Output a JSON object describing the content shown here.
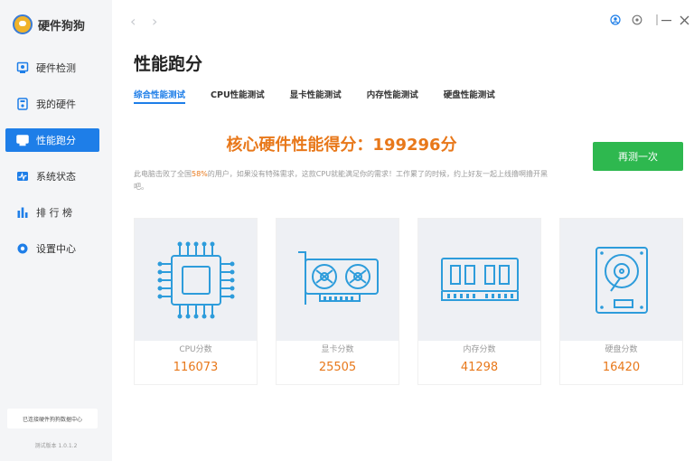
{
  "app": {
    "name": "硬件狗狗"
  },
  "sidebar": {
    "items": [
      {
        "label": "硬件检测",
        "icon": "hardware-scan-icon"
      },
      {
        "label": "我的硬件",
        "icon": "my-hardware-icon"
      },
      {
        "label": "性能跑分",
        "icon": "benchmark-icon",
        "active": true
      },
      {
        "label": "系统状态",
        "icon": "system-status-icon"
      },
      {
        "label": "排 行 榜",
        "icon": "ranking-icon"
      },
      {
        "label": "设置中心",
        "icon": "settings-icon"
      }
    ],
    "feedback_label": "已连接硬件狗狗数据中心",
    "version": "测试版本 1.0.1.2"
  },
  "page": {
    "title": "性能跑分"
  },
  "tabs": [
    {
      "label": "综合性能测试",
      "active": true
    },
    {
      "label": "CPU性能测试"
    },
    {
      "label": "显卡性能测试"
    },
    {
      "label": "内存性能测试"
    },
    {
      "label": "硬盘性能测试"
    }
  ],
  "score": {
    "headline": "核心硬件性能得分：199296分"
  },
  "retest_label": "再测一次",
  "description": {
    "prefix": "此电脑击败了全国",
    "percent": "58%",
    "suffix": "的用户，如果没有特殊需求，这款CPU就能满足你的需求！工作累了的时候，约上好友一起上线撸啊撸开黑吧。"
  },
  "cards": [
    {
      "label": "CPU分数",
      "value": "116073",
      "icon": "cpu-icon"
    },
    {
      "label": "显卡分数",
      "value": "25505",
      "icon": "graphics-card-icon"
    },
    {
      "label": "内存分数",
      "value": "41298",
      "icon": "memory-icon"
    },
    {
      "label": "硬盘分数",
      "value": "16420",
      "icon": "hard-disk-icon"
    }
  ],
  "colors": {
    "accent": "#1e7ee8",
    "score": "#e8781a",
    "retest_button": "#2eb84f",
    "illustration": "#2d9cdb"
  }
}
